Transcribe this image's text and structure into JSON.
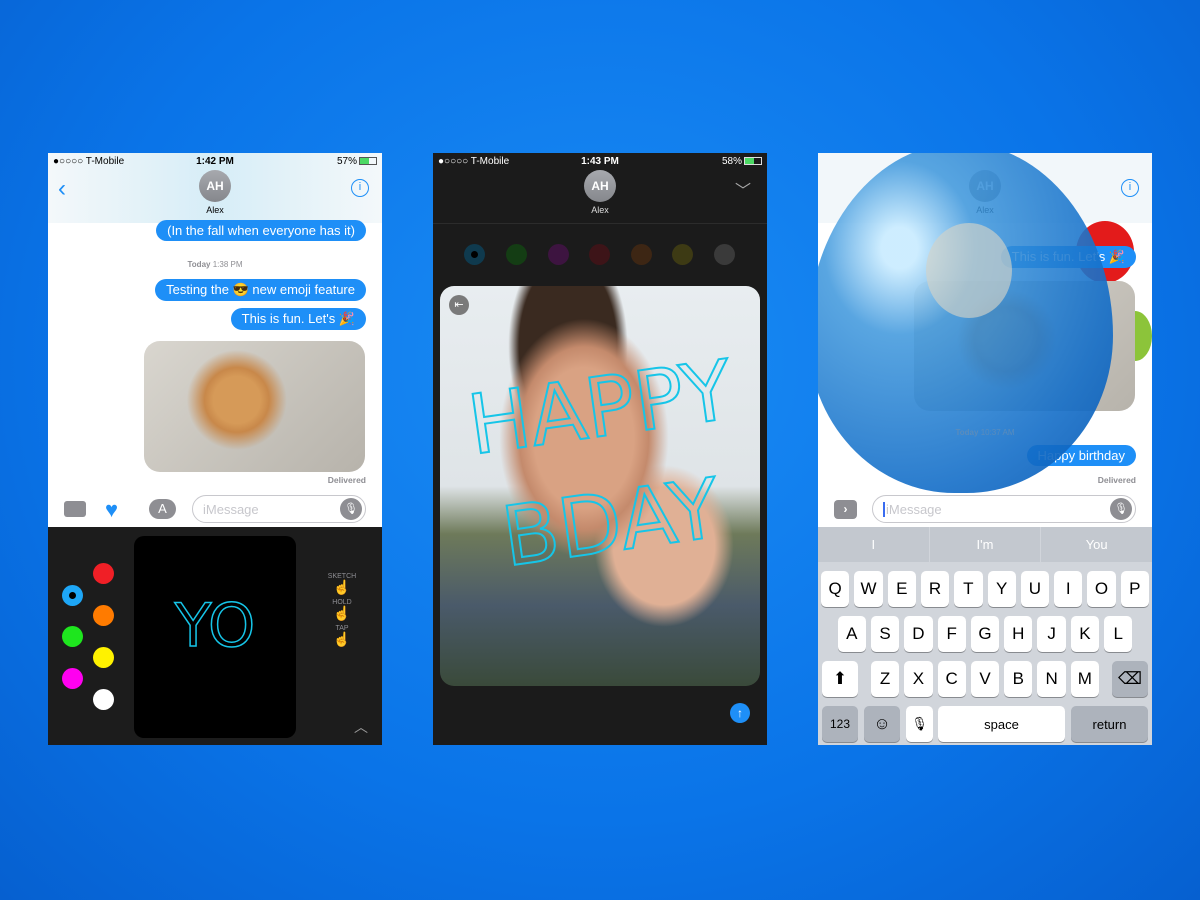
{
  "colors": {
    "background": "#0a74e8",
    "bubble": "#1e8ff7",
    "ink": "#16c5e8",
    "drawing_panel": "#1c1c1c"
  },
  "phone1": {
    "status": {
      "carrier": "●○○○○ T-Mobile",
      "time": "1:42 PM",
      "battery": "57%",
      "battery_level": 57
    },
    "contact": {
      "initials": "AH",
      "name": "Alex"
    },
    "messages": [
      "(In the fall when everyone has it)",
      "Testing the 😎 new emoji feature",
      "This is fun. Let's 🎉"
    ],
    "timestamp": {
      "day": "Today",
      "time": "1:38 PM"
    },
    "delivered": "Delivered",
    "input_placeholder": "iMessage",
    "sketch": {
      "text": "YO"
    },
    "modes": [
      "SKETCH",
      "HOLD",
      "TAP"
    ],
    "palette": [
      "#1ea7f7",
      "#f01f26",
      "#ff7b00",
      "#1ee61e",
      "#fff200",
      "#ff00f0",
      "#ffffff"
    ]
  },
  "phone2": {
    "status": {
      "carrier": "●○○○○ T-Mobile",
      "time": "1:43 PM",
      "battery": "58%",
      "battery_level": 58
    },
    "contact": {
      "initials": "AH",
      "name": "Alex"
    },
    "palette": [
      "#0f3a4e",
      "#143d14",
      "#3d1440",
      "#3d1418",
      "#3d2614",
      "#3d3a14",
      "#3a3a3a"
    ],
    "drawing": {
      "line1": "HAPPY",
      "line2": "BDAY"
    }
  },
  "phone3": {
    "contact": {
      "initials": "AH",
      "name": "Alex"
    },
    "messages": [
      "This is fun. Let's 🎉",
      "Happy birthday"
    ],
    "timestamp": {
      "day": "Today",
      "time": "10:37 AM"
    },
    "delivered": "Delivered",
    "input_placeholder": "iMessage",
    "suggestions": [
      "I",
      "I'm",
      "You"
    ],
    "keys": {
      "row1": [
        "Q",
        "W",
        "E",
        "R",
        "T",
        "Y",
        "U",
        "I",
        "O",
        "P"
      ],
      "row2": [
        "A",
        "S",
        "D",
        "F",
        "G",
        "H",
        "J",
        "K",
        "L"
      ],
      "row3": [
        "Z",
        "X",
        "C",
        "V",
        "B",
        "N",
        "M"
      ],
      "numbers": "123",
      "space": "space",
      "return": "return"
    }
  }
}
